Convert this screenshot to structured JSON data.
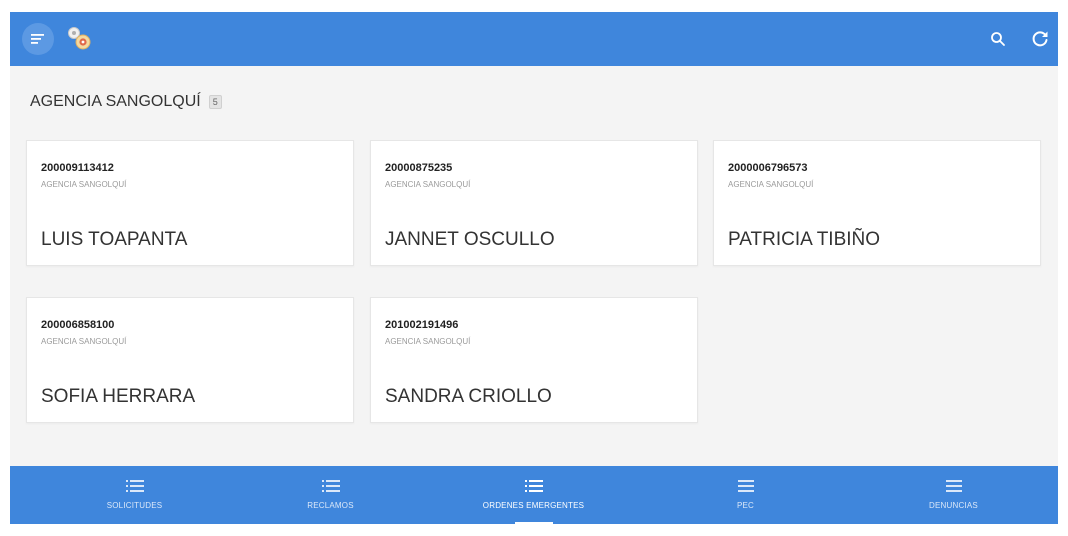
{
  "header": {
    "menu_icon": "menu-lines-icon",
    "logo_icon": "gears-logo-icon",
    "search_icon": "search-icon",
    "refresh_icon": "refresh-icon",
    "color": "#3f86dc"
  },
  "section": {
    "title": "AGENCIA SANGOLQUÍ",
    "count": "5"
  },
  "cards": [
    {
      "number": "200009113412",
      "agency": "AGENCIA SANGOLQUÍ",
      "name": "LUIS TOAPANTA"
    },
    {
      "number": "20000875235",
      "agency": "AGENCIA SANGOLQUÍ",
      "name": "JANNET OSCULLO"
    },
    {
      "number": "2000006796573",
      "agency": "AGENCIA SANGOLQUÍ",
      "name": "PATRICIA TIBIÑO"
    },
    {
      "number": "200006858100",
      "agency": "AGENCIA SANGOLQUÍ",
      "name": "SOFIA HERRARA"
    },
    {
      "number": "201002191496",
      "agency": "AGENCIA SANGOLQUÍ",
      "name": "SANDRA CRIOLLO"
    }
  ],
  "bottom_nav": {
    "items": [
      {
        "label": "SOLICITUDES",
        "icon": "bulleted-list-icon",
        "active": false
      },
      {
        "label": "RECLAMOS",
        "icon": "bulleted-list-icon",
        "active": false
      },
      {
        "label": "ORDENES EMERGENTES",
        "icon": "bulleted-list-icon",
        "active": true
      },
      {
        "label": "PEC",
        "icon": "hamburger-icon",
        "active": false
      },
      {
        "label": "DENUNCIAS",
        "icon": "hamburger-icon",
        "active": false
      }
    ]
  }
}
